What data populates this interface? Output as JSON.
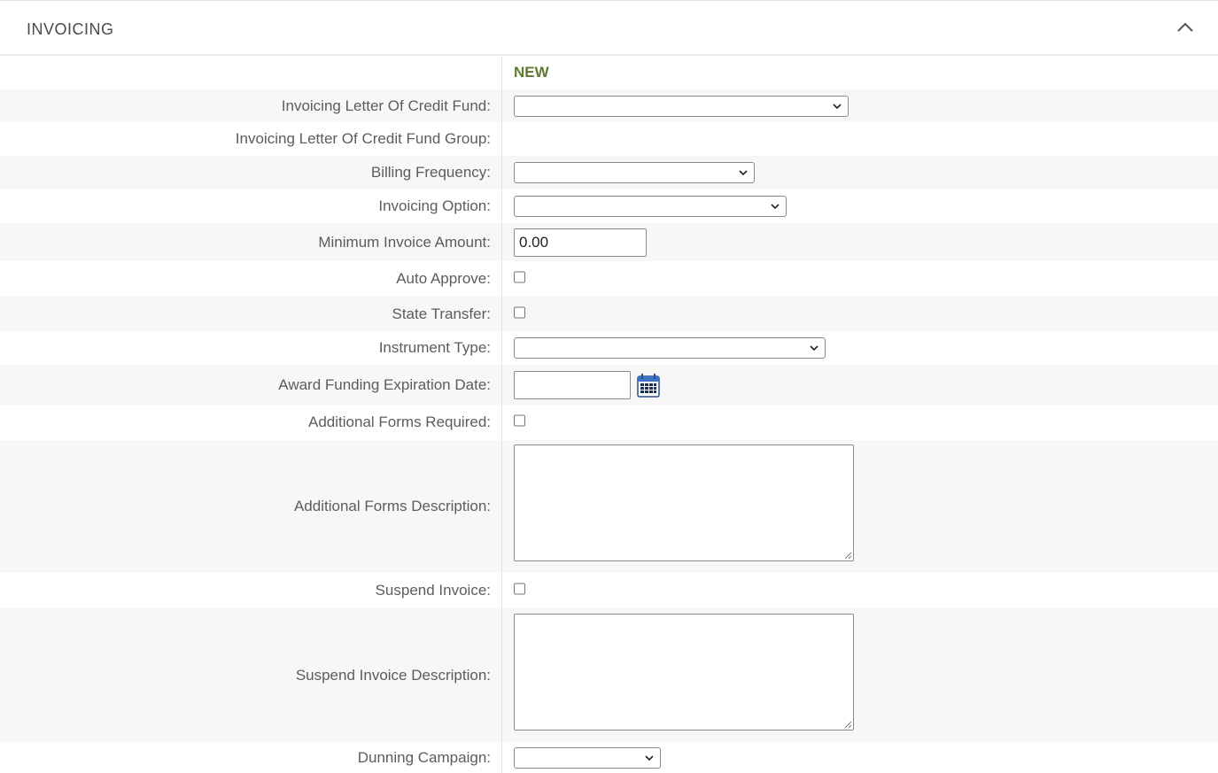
{
  "section": {
    "title": "INVOICING",
    "collapse_icon": "chevron-up-icon"
  },
  "column_header": "NEW",
  "fields": {
    "loc_fund": {
      "label": "Invoicing Letter Of Credit Fund:",
      "value": ""
    },
    "loc_fund_group": {
      "label": "Invoicing Letter Of Credit Fund Group:",
      "value": ""
    },
    "billing_frequency": {
      "label": "Billing Frequency:",
      "value": ""
    },
    "invoicing_option": {
      "label": "Invoicing Option:",
      "value": ""
    },
    "min_invoice_amount": {
      "label": "Minimum Invoice Amount:",
      "value": "0.00"
    },
    "auto_approve": {
      "label": "Auto Approve:",
      "checked": false
    },
    "state_transfer": {
      "label": "State Transfer:",
      "checked": false
    },
    "instrument_type": {
      "label": "Instrument Type:",
      "value": ""
    },
    "award_funding_expiration_date": {
      "label": "Award Funding Expiration Date:",
      "value": "",
      "icon": "calendar-icon"
    },
    "additional_forms_required": {
      "label": "Additional Forms Required:",
      "checked": false
    },
    "additional_forms_description": {
      "label": "Additional Forms Description:",
      "value": ""
    },
    "suspend_invoice": {
      "label": "Suspend Invoice:",
      "checked": false
    },
    "suspend_invoice_description": {
      "label": "Suspend Invoice Description:",
      "value": ""
    },
    "dunning_campaign": {
      "label": "Dunning Campaign:",
      "value": ""
    }
  }
}
